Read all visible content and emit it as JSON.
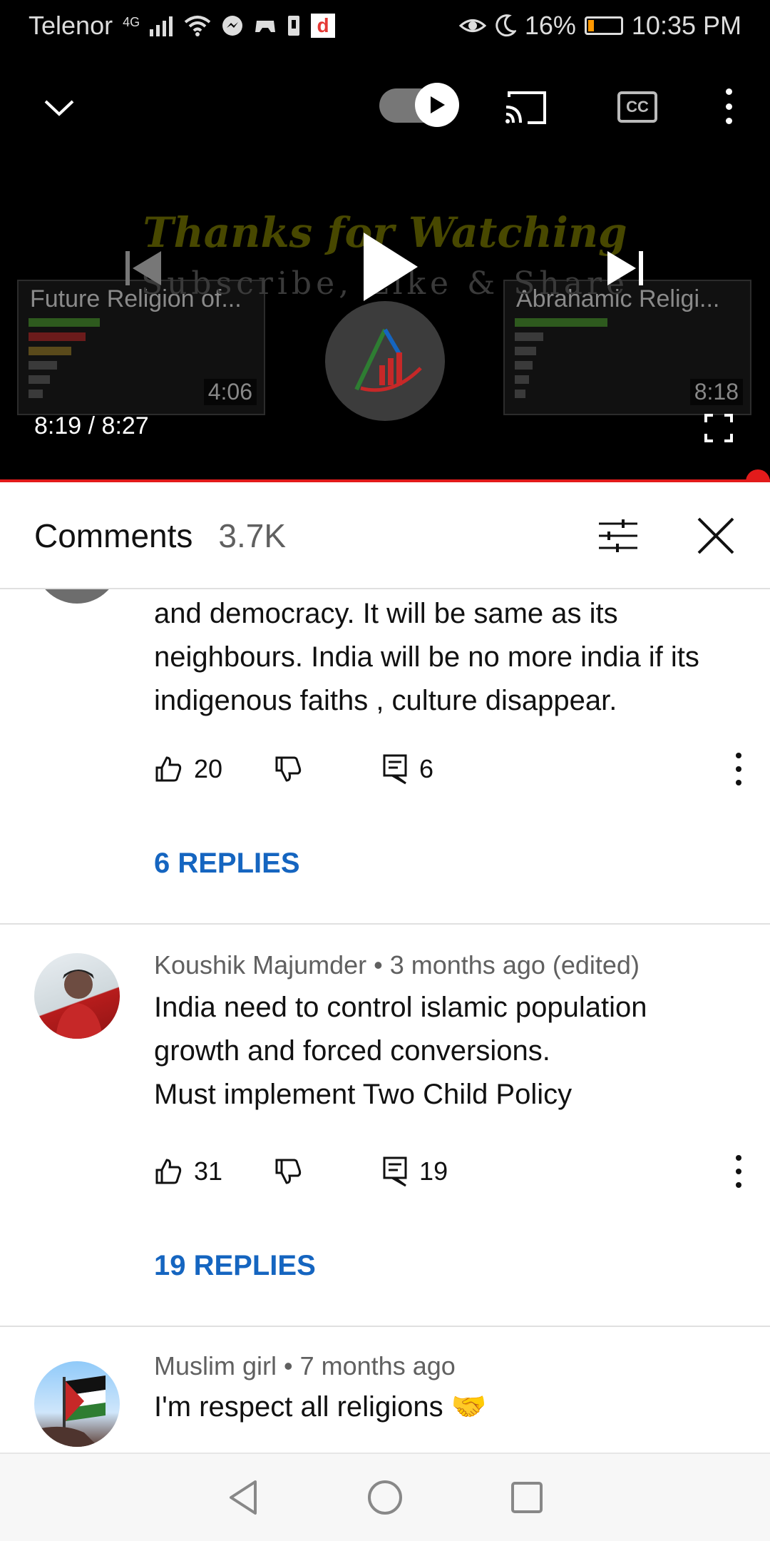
{
  "status_bar": {
    "carrier": "Telenor",
    "network": "4G",
    "battery_percent": "16%",
    "battery_level": 0.16,
    "time": "10:35 PM",
    "icons": [
      "signal-icon",
      "wifi-icon",
      "messenger-icon",
      "game-icon",
      "sim-icon",
      "d-app-icon",
      "eye-icon",
      "moon-icon",
      "battery-icon"
    ],
    "d_app_letter": "d"
  },
  "player": {
    "overlay_title": "Thanks for Watching",
    "overlay_subtitle": "Subscribe, Like & Share",
    "current_time": "8:19",
    "separator": " / ",
    "duration": "8:27",
    "progress": 0.9842,
    "cc_label": "CC",
    "end_cards": [
      {
        "title": "Future Religion of...",
        "duration": "4:06"
      },
      {
        "title": "Abrahamic Religi...",
        "duration": "8:18"
      }
    ],
    "controls": [
      "collapse-icon",
      "autoplay-toggle",
      "cast-icon",
      "cc-icon",
      "more-icon",
      "previous-icon",
      "play-icon",
      "next-icon",
      "fullscreen-icon"
    ]
  },
  "comments_header": {
    "title": "Comments",
    "count": "3.7K"
  },
  "comments": [
    {
      "author_meta": "",
      "text": "and democracy. It will be same as its neighbours. India will be no more india if its indigenous faiths , culture  disappear.",
      "likes": "20",
      "reply_count": "6",
      "replies_label": "6 REPLIES"
    },
    {
      "author_meta": "Koushik Majumder • 3 months ago (edited)",
      "text": "India need to control islamic population growth and forced conversions.\nMust implement Two Child Policy",
      "likes": "31",
      "reply_count": "19",
      "replies_label": "19 REPLIES"
    },
    {
      "author_meta": "Muslim girl • 7 months ago",
      "text": "I'm respect all religions 🤝",
      "likes": "",
      "reply_count": "",
      "replies_label": ""
    }
  ],
  "nav_bar": {
    "buttons": [
      "back-icon",
      "home-icon",
      "recents-icon"
    ]
  },
  "colors": {
    "accent_red": "#e21b1b",
    "link_blue": "#1565c0",
    "battery_orange": "#ff9800"
  }
}
